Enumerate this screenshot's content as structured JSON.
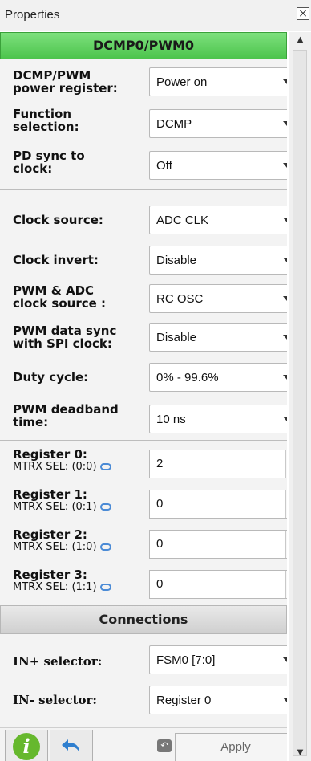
{
  "window": {
    "title": "Properties",
    "close_glyph": "×"
  },
  "component_header": "DCMP0/PWM0",
  "rows": [
    {
      "label_line1": "DCMP/PWM",
      "label_line2": "power register:",
      "value": "Power on"
    },
    {
      "label_line1": "Function",
      "label_line2": "selection:",
      "value": "DCMP"
    },
    {
      "label_line1": "PD sync to",
      "label_line2": "clock:",
      "value": "Off"
    },
    {
      "label_line1": "Clock source:",
      "value": "ADC CLK"
    },
    {
      "label_line1": "Clock invert:",
      "value": "Disable"
    },
    {
      "label_line1": "PWM & ADC",
      "label_line2": "clock source :",
      "value": "RC OSC"
    },
    {
      "label_line1": "PWM data sync",
      "label_line2": "with SPI clock:",
      "value": "Disable"
    },
    {
      "label_line1": "Duty cycle:",
      "value": "0% - 99.6%"
    },
    {
      "label_line1": "PWM deadband",
      "label_line2": "time:",
      "value": "10 ns"
    }
  ],
  "registers": [
    {
      "label": "Register 0:",
      "sub": "MTRX SEL: (0:0)",
      "value": "2"
    },
    {
      "label": "Register 1:",
      "sub": "MTRX SEL: (0:1)",
      "value": "0"
    },
    {
      "label": "Register 2:",
      "sub": "MTRX SEL: (1:0)",
      "value": "0"
    },
    {
      "label": "Register 3:",
      "sub": "MTRX SEL: (1:1)",
      "value": "0"
    }
  ],
  "connections_header": "Connections",
  "connections": [
    {
      "label": "IN+ selector:",
      "value": "FSM0 [7:0]"
    },
    {
      "label": "IN- selector:",
      "value": "Register 0"
    }
  ],
  "toolbar": {
    "info_glyph": "i",
    "small_undo_glyph": "↶",
    "apply_label": "Apply"
  },
  "colors": {
    "header_green": "#4cc44c",
    "info_green": "#66b82d",
    "undo_blue": "#2f7fcf"
  }
}
